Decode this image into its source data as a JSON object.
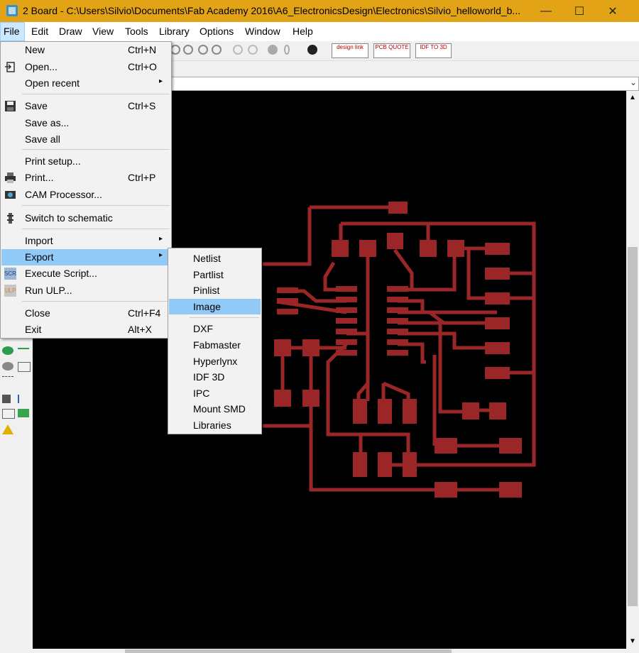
{
  "window": {
    "title": "2 Board - C:\\Users\\Silvio\\Documents\\Fab Academy 2016\\A6_ElectronicsDesign\\Electronics\\Silvio_helloworld_b...",
    "controls": [
      "minimize-icon",
      "maximize-icon",
      "close-icon"
    ],
    "accent_color": "#e2a317"
  },
  "menubar": [
    "File",
    "Edit",
    "Draw",
    "View",
    "Tools",
    "Library",
    "Options",
    "Window",
    "Help"
  ],
  "toolbar": {
    "design_link": "design link",
    "pcb_quote": "PCB QUOTE",
    "idf_to_3d": "IDF TO 3D"
  },
  "file_menu": {
    "items": [
      {
        "label": "New",
        "shortcut": "Ctrl+N",
        "icon": ""
      },
      {
        "label": "Open...",
        "shortcut": "Ctrl+O",
        "icon": "open-icon"
      },
      {
        "label": "Open recent",
        "shortcut": "",
        "icon": "",
        "submenu": true
      },
      {
        "label": "Save",
        "shortcut": "Ctrl+S",
        "icon": "save-icon"
      },
      {
        "label": "Save as...",
        "shortcut": "",
        "icon": ""
      },
      {
        "label": "Save all",
        "shortcut": "",
        "icon": ""
      },
      {
        "label": "Print setup...",
        "shortcut": "",
        "icon": ""
      },
      {
        "label": "Print...",
        "shortcut": "Ctrl+P",
        "icon": "printer-icon"
      },
      {
        "label": "CAM Processor...",
        "shortcut": "",
        "icon": "cam-icon"
      },
      {
        "label": "Switch to schematic",
        "shortcut": "",
        "icon": "switch-icon"
      },
      {
        "label": "Import",
        "shortcut": "",
        "icon": "",
        "submenu": true
      },
      {
        "label": "Export",
        "shortcut": "",
        "icon": "",
        "submenu": true,
        "highlighted": true
      },
      {
        "label": "Execute Script...",
        "shortcut": "",
        "icon": "script-icon",
        "icon_text": "SCR"
      },
      {
        "label": "Run ULP...",
        "shortcut": "",
        "icon": "ulp-icon",
        "icon_text": "ULP"
      },
      {
        "label": "Close",
        "shortcut": "Ctrl+F4",
        "icon": ""
      },
      {
        "label": "Exit",
        "shortcut": "Alt+X",
        "icon": ""
      }
    ]
  },
  "export_submenu": {
    "items": [
      {
        "label": "Netlist"
      },
      {
        "label": "Partlist"
      },
      {
        "label": "Pinlist"
      },
      {
        "label": "Image",
        "highlighted": true
      },
      {
        "label": "DXF"
      },
      {
        "label": "Fabmaster"
      },
      {
        "label": "Hyperlynx"
      },
      {
        "label": "IDF 3D"
      },
      {
        "label": "IPC"
      },
      {
        "label": "Mount SMD"
      },
      {
        "label": "Libraries"
      }
    ]
  },
  "board": {
    "background": "#000000",
    "copper_color": "#9b2628"
  },
  "colors": {
    "highlight": "#91c9f7",
    "menu_bg": "#f2f2f2"
  }
}
